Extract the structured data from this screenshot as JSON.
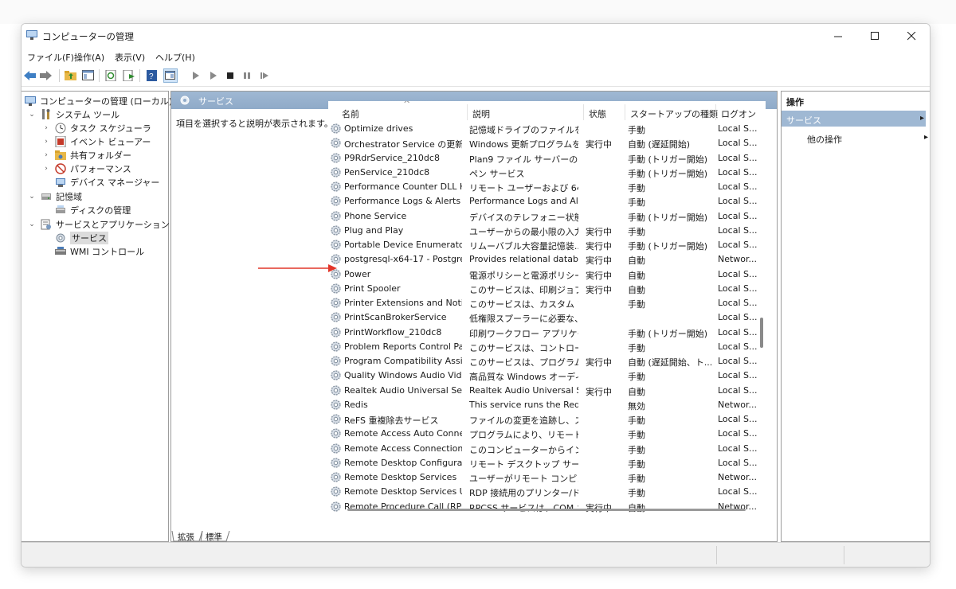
{
  "window": {
    "title": "コンピューターの管理",
    "controls": {
      "minimize": "—",
      "maximize": "☐",
      "close": "✕"
    }
  },
  "menu": [
    "ファイル(F)",
    "操作(A)",
    "表示(V)",
    "ヘルプ(H)"
  ],
  "tree": {
    "items": [
      {
        "label": "コンピューターの管理 (ローカル)",
        "icon": "computer-management-icon",
        "level": 0,
        "chevron": ""
      },
      {
        "label": "システム ツール",
        "icon": "tools-icon",
        "level": 1,
        "chevron": "⌄"
      },
      {
        "label": "タスク スケジューラ",
        "icon": "clock-icon",
        "level": 2,
        "chevron": "›"
      },
      {
        "label": "イベント ビューアー",
        "icon": "event-viewer-icon",
        "level": 2,
        "chevron": "›"
      },
      {
        "label": "共有フォルダー",
        "icon": "shared-folder-icon",
        "level": 2,
        "chevron": "›"
      },
      {
        "label": "パフォーマンス",
        "icon": "performance-icon",
        "level": 2,
        "chevron": "›"
      },
      {
        "label": "デバイス マネージャー",
        "icon": "device-manager-icon",
        "level": 2,
        "chevron": ""
      },
      {
        "label": "記憶域",
        "icon": "storage-icon",
        "level": 1,
        "chevron": "⌄"
      },
      {
        "label": "ディスクの管理",
        "icon": "disk-icon",
        "level": 2,
        "chevron": ""
      },
      {
        "label": "サービスとアプリケーション",
        "icon": "services-apps-icon",
        "level": 1,
        "chevron": "⌄"
      },
      {
        "label": "サービス",
        "icon": "services-icon",
        "level": 2,
        "chevron": "",
        "selected": true
      },
      {
        "label": "WMI コントロール",
        "icon": "wmi-icon",
        "level": 2,
        "chevron": ""
      }
    ]
  },
  "center": {
    "header": "サービス",
    "description_prompt": "項目を選択すると説明が表示されます。",
    "sort_indicator": "^",
    "columns": [
      "名前",
      "説明",
      "状態",
      "スタートアップの種類",
      "ログオン"
    ],
    "rows": [
      [
        "Optimize drives",
        "記憶域ドライブのファイルを...",
        "",
        "手動",
        "Local S..."
      ],
      [
        "Orchestrator Service の更新",
        "Windows 更新プログラムを...",
        "実行中",
        "自動 (遅延開始)",
        "Local S..."
      ],
      [
        "P9RdrService_210dc8",
        "Plan9 ファイル サーバーのトリ...",
        "",
        "手動 (トリガー開始)",
        "Local S..."
      ],
      [
        "PenService_210dc8",
        "ペン サービス",
        "",
        "手動 (トリガー開始)",
        "Local S..."
      ],
      [
        "Performance Counter DLL H...",
        "リモート ユーザーおよび 64 ビッ...",
        "",
        "手動",
        "Local S..."
      ],
      [
        "Performance Logs & Alerts",
        "Performance Logs and Al...",
        "",
        "手動",
        "Local S..."
      ],
      [
        "Phone Service",
        "デバイスのテレフォニー状態を...",
        "",
        "手動 (トリガー開始)",
        "Local S..."
      ],
      [
        "Plug and Play",
        "ユーザーからの最小限の入力...",
        "実行中",
        "手動",
        "Local S..."
      ],
      [
        "Portable Device Enumerator ...",
        "リムーバブル大容量記憶装...",
        "実行中",
        "手動 (トリガー開始)",
        "Local S..."
      ],
      [
        "postgresql-x64-17 - Postgre...",
        "Provides relational datab...",
        "実行中",
        "自動",
        "Networ..."
      ],
      [
        "Power",
        "電源ポリシーと電源ポリシー...",
        "実行中",
        "自動",
        "Local S..."
      ],
      [
        "Print Spooler",
        "このサービスは、印刷ジョブを...",
        "実行中",
        "自動",
        "Local S..."
      ],
      [
        "Printer Extensions and Notifi...",
        "このサービスは、カスタム プリ...",
        "",
        "手動",
        "Local S..."
      ],
      [
        "PrintScanBrokerService",
        "低権限スプーラーに必要な、...",
        "",
        "",
        "Local S..."
      ],
      [
        "PrintWorkflow_210dc8",
        "印刷ワークフロー アプリケーシ...",
        "",
        "手動 (トリガー開始)",
        "Local S..."
      ],
      [
        "Problem Reports Control Pa...",
        "このサービスは、コントロール パ...",
        "",
        "手動",
        "Local S..."
      ],
      [
        "Program Compatibility Assis...",
        "このサービスは、プログラム互...",
        "実行中",
        "自動 (遅延開始、ト...",
        "Local S..."
      ],
      [
        "Quality Windows Audio Vid...",
        "高品質な Windows オーディ...",
        "",
        "手動",
        "Local S..."
      ],
      [
        "Realtek Audio Universal Serv...",
        "Realtek Audio Universal S...",
        "実行中",
        "自動",
        "Local S..."
      ],
      [
        "Redis",
        "This service runs the Redi...",
        "",
        "無効",
        "Networ..."
      ],
      [
        "ReFS 重複除去サービス",
        "ファイルの変更を追跡し、ス...",
        "",
        "手動",
        "Local S..."
      ],
      [
        "Remote Access Auto Connec...",
        "プログラムにより、リモート DN...",
        "",
        "手動",
        "Local S..."
      ],
      [
        "Remote Access Connection ...",
        "このコンピューターからインター...",
        "",
        "手動",
        "Local S..."
      ],
      [
        "Remote Desktop Configurati...",
        "リモート デスクトップ サービスと...",
        "",
        "手動",
        "Local S..."
      ],
      [
        "Remote Desktop Services",
        "ユーザーがリモート コンピュータ...",
        "",
        "手動",
        "Networ..."
      ],
      [
        "Remote Desktop Services Us...",
        "RDP 接続用のプリンター/ドラ...",
        "",
        "手動",
        "Local S..."
      ],
      [
        "Remote Procedure Call (RPC)",
        "RPCSS サービスは、COM お...",
        "実行中",
        "自動",
        "Networ..."
      ]
    ],
    "tabs": [
      "拡張",
      "標準"
    ]
  },
  "actions": {
    "title": "操作",
    "section": "サービス",
    "section_arrow": "▸",
    "item": "他の操作",
    "item_arrow": "▸"
  },
  "colors": {
    "pane_header": "#9fb8d3",
    "selection": "#dcdcdc",
    "annotation_arrow": "#e2362a"
  }
}
